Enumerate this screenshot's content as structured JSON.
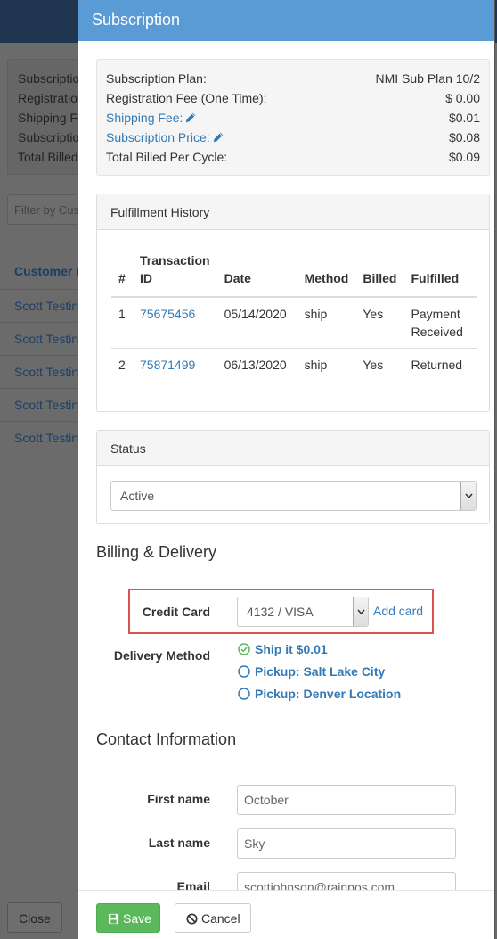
{
  "background": {
    "summary_labels": [
      "Subscription",
      "Registration",
      "Shipping Fee",
      "Subscription",
      "Total Billed"
    ],
    "filter_placeholder": "Filter by Customer",
    "column_header": "Customer Name",
    "rows": [
      "Scott Testing",
      "Scott Testing",
      "Scott Testing",
      "Scott Testing",
      "Scott Testing"
    ],
    "close_label": "Close"
  },
  "modal": {
    "title": "Subscription",
    "summary": {
      "plan_label": "Subscription Plan:",
      "plan_value": "NMI Sub Plan 10/2",
      "reg_label": "Registration Fee (One Time):",
      "reg_value": "$ 0.00",
      "ship_label": "Shipping Fee:",
      "ship_value": "$0.01",
      "price_label": "Subscription Price:",
      "price_value": "$0.08",
      "total_label": "Total Billed Per Cycle:",
      "total_value": "$0.09"
    },
    "fulfillment": {
      "heading": "Fulfillment History",
      "columns": [
        "#",
        "Transaction ID",
        "Date",
        "Method",
        "Billed",
        "Fulfilled"
      ],
      "rows": [
        {
          "num": "1",
          "txid": "75675456",
          "date": "05/14/2020",
          "method": "ship",
          "billed": "Yes",
          "fulfilled": "Payment Received"
        },
        {
          "num": "2",
          "txid": "75871499",
          "date": "06/13/2020",
          "method": "ship",
          "billed": "Yes",
          "fulfilled": "Returned"
        }
      ]
    },
    "status": {
      "heading": "Status",
      "selected": "Active"
    },
    "billing": {
      "title": "Billing & Delivery",
      "credit_card_label": "Credit Card",
      "credit_card_value": "4132 / VISA",
      "add_card": "Add card",
      "delivery_label": "Delivery Method",
      "options": [
        {
          "label": "Ship it $0.01",
          "selected": true
        },
        {
          "label": "Pickup: Salt Lake City",
          "selected": false
        },
        {
          "label": "Pickup: Denver Location",
          "selected": false
        }
      ]
    },
    "contact": {
      "title": "Contact Information",
      "first_name_label": "First name",
      "first_name_value": "October",
      "last_name_label": "Last name",
      "last_name_value": "Sky",
      "email_label": "Email",
      "email_value": "scottjohnson@rainpos.com"
    },
    "footer": {
      "save_label": "Save",
      "cancel_label": "Cancel"
    },
    "colors": {
      "header": "#5b9bd5",
      "link": "#337ab7",
      "save": "#5cb85c",
      "highlight": "#d9534f"
    }
  }
}
